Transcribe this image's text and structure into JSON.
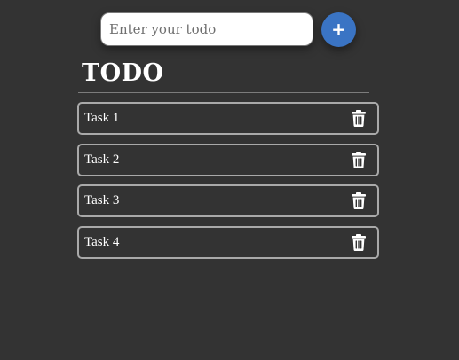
{
  "app": {
    "title": "TODO"
  },
  "input": {
    "placeholder": "Enter your todo",
    "value": ""
  },
  "add_button": {
    "label": "+",
    "icon": "plus-icon",
    "color": "#3a74c4"
  },
  "tasks": [
    {
      "label": "Task 1",
      "action_icon": "trash-icon"
    },
    {
      "label": "Task 2",
      "action_icon": "trash-icon"
    },
    {
      "label": "Task 3",
      "action_icon": "trash-icon"
    },
    {
      "label": "Task 4",
      "action_icon": "trash-icon"
    }
  ],
  "theme": {
    "background": "#333333",
    "text": "#ffffff",
    "item_border": "#a9a9a9"
  }
}
